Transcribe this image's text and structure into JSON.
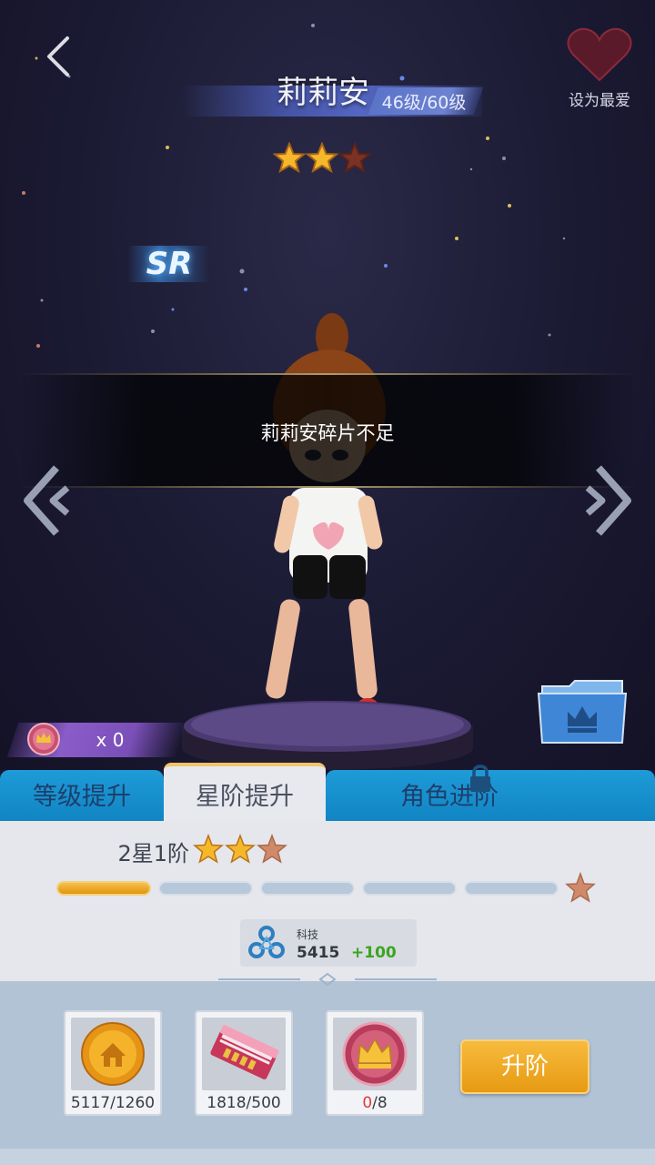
{
  "header": {
    "character_name": "莉莉安",
    "level_text": "46级/60级",
    "favorite_label": "设为最爱",
    "star_rating": 2,
    "rarity": "SR"
  },
  "toast": {
    "message": "莉莉安碎片不足"
  },
  "token": {
    "count_text": "x 0"
  },
  "tabs": {
    "level_up": "等级提升",
    "star_up": "星阶提升",
    "advance": "角色进阶",
    "active": "星阶提升"
  },
  "star_rank": {
    "label": "2星1阶",
    "filled_segments": 1,
    "total_segments": 5
  },
  "tech": {
    "label": "科技",
    "value": "5415",
    "bonus": "+100"
  },
  "materials": [
    {
      "icon": "gold-coin-icon",
      "count": "5117/1260",
      "owned": "5117",
      "required": "1260"
    },
    {
      "icon": "book-icon",
      "count": "1818/500",
      "owned": "1818",
      "required": "500"
    },
    {
      "icon": "crown-token-icon",
      "count": "0/8",
      "owned": "0",
      "required": "/8"
    }
  ],
  "upgrade_button": "升阶",
  "colors": {
    "accent_gold": "#e79a12",
    "tab_blue": "#1185c3",
    "progress_fill": "#f6c14b",
    "bonus_green": "#3aa520",
    "insufficient_red": "#e03a3a"
  }
}
